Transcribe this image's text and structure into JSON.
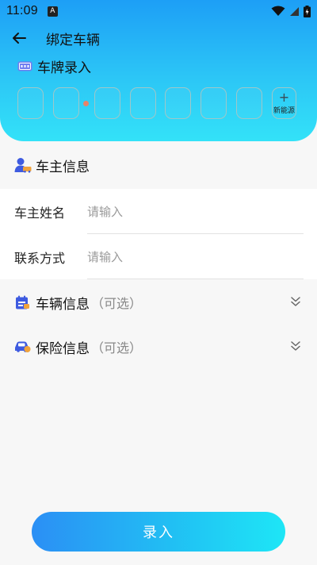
{
  "status_bar": {
    "time": "11:09",
    "notification_letter": "A"
  },
  "header": {
    "title": "绑定车辆"
  },
  "plate": {
    "section_label": "车牌录入",
    "slot_count": 7,
    "new_energy_label": "新能源",
    "new_energy_plus": "+"
  },
  "owner": {
    "section_title": "车主信息",
    "name_label": "车主姓名",
    "name_placeholder": "请输入",
    "contact_label": "联系方式",
    "contact_placeholder": "请输入"
  },
  "vehicle": {
    "title": "车辆信息",
    "optional": "（可选）"
  },
  "insurance": {
    "title": "保险信息",
    "optional": "（可选）"
  },
  "submit": {
    "label": "录入"
  },
  "colors": {
    "accent": "#1d9ff6",
    "accent_end": "#33e2f8",
    "icon_blue": "#3e5be0",
    "plate_dot": "#e7846a"
  }
}
